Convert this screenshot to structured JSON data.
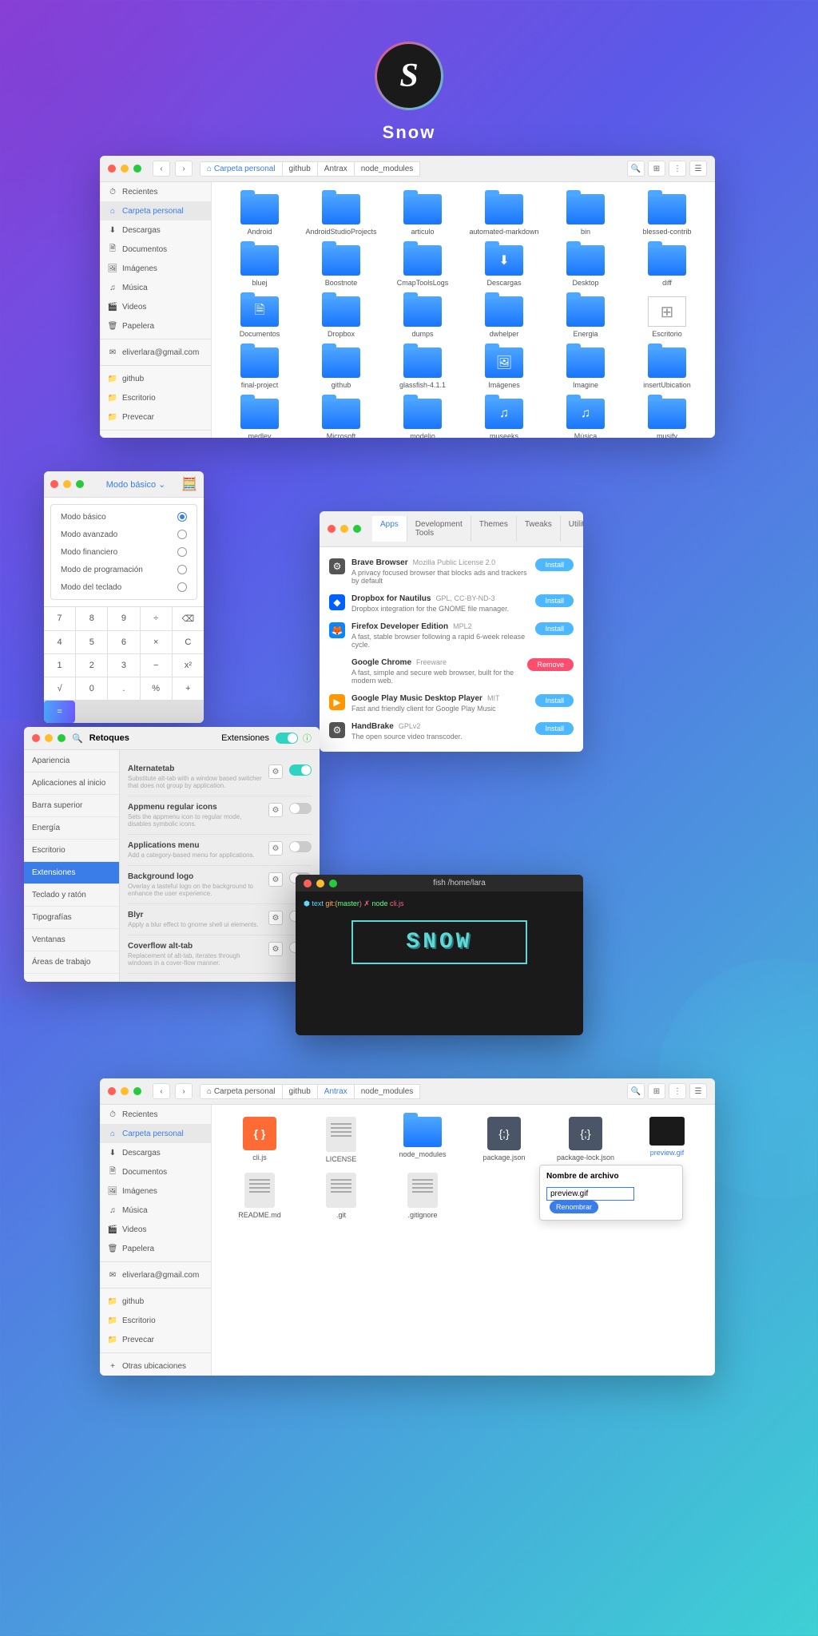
{
  "brand": {
    "letter": "S",
    "name": "Snow"
  },
  "fm": {
    "breadcrumbs": [
      "Carpeta personal",
      "github",
      "Antrax",
      "node_modules"
    ],
    "sidebar": [
      {
        "icon": "⏱",
        "label": "Recientes"
      },
      {
        "icon": "⌂",
        "label": "Carpeta personal",
        "active": true
      },
      {
        "icon": "⬇",
        "label": "Descargas"
      },
      {
        "icon": "🗎",
        "label": "Documentos"
      },
      {
        "icon": "🖼",
        "label": "Imágenes"
      },
      {
        "icon": "♫",
        "label": "Música"
      },
      {
        "icon": "🎬",
        "label": "Videos"
      },
      {
        "icon": "🗑",
        "label": "Papelera"
      },
      {
        "sep": true
      },
      {
        "icon": "✉",
        "label": "eliverlara@gmail.com"
      },
      {
        "sep": true
      },
      {
        "icon": "📁",
        "label": "github"
      },
      {
        "icon": "📁",
        "label": "Escritorio"
      },
      {
        "icon": "📁",
        "label": "Prevecar"
      },
      {
        "sep": true
      },
      {
        "icon": "+",
        "label": "Otras ubicaciones"
      }
    ],
    "folders": [
      "Android",
      "AndroidStudioProjects",
      "articulo",
      "automated-markdown",
      "bin",
      "blessed-contrib",
      "bluej",
      "Boostnote",
      "CmapToolsLogs",
      "Descargas",
      "Desktop",
      "diff",
      "Documentos",
      "Dropbox",
      "dumps",
      "dwhelper",
      "Energia",
      "Escritorio",
      "final-project",
      "github",
      "glassfish-4.1.1",
      "Imágenes",
      "Imagine",
      "insertUbication",
      "medley",
      "Microsoft",
      "modelio",
      "museeks",
      "Música",
      "musify"
    ]
  },
  "calc": {
    "title": "Modo básico",
    "options": [
      "Modo básico",
      "Modo avanzado",
      "Modo financiero",
      "Modo de programación",
      "Modo del teclado"
    ],
    "selected": 0,
    "keys": [
      "7",
      "8",
      "9",
      "÷",
      "⌫",
      "4",
      "5",
      "6",
      "×",
      "C",
      "1",
      "2",
      "3",
      "−",
      "x²",
      "√",
      "0",
      ".",
      "%",
      "+",
      "="
    ]
  },
  "sw": {
    "tabs": [
      "Apps",
      "Development Tools",
      "Themes",
      "Tweaks",
      "Utilities"
    ],
    "activeTab": 0,
    "items": [
      {
        "name": "Brave Browser",
        "lic": "Mozilla Public License 2.0",
        "desc": "A privacy focused browser that blocks ads and trackers by default",
        "btn": "Install",
        "icon": "⚙",
        "bg": "#555"
      },
      {
        "name": "Dropbox for Nautilus",
        "lic": "GPL, CC-BY-ND-3",
        "desc": "Dropbox integration for the GNOME file manager.",
        "btn": "Install",
        "icon": "◆",
        "bg": "#0061ff"
      },
      {
        "name": "Firefox Developer Edition",
        "lic": "MPL2",
        "desc": "A fast, stable browser following a rapid 6-week release cycle.",
        "btn": "Install",
        "icon": "🦊",
        "bg": "#0a84ff"
      },
      {
        "name": "Google Chrome",
        "lic": "Freeware",
        "desc": "A fast, simple and secure web browser, built for the modern web.",
        "btn": "Remove",
        "icon": "●",
        "bg": "#fff"
      },
      {
        "name": "Google Play Music Desktop Player",
        "lic": "MIT",
        "desc": "Fast and friendly client for Google Play Music",
        "btn": "Install",
        "icon": "▶",
        "bg": "#ff9800"
      },
      {
        "name": "HandBrake",
        "lic": "GPLv2",
        "desc": "The open source video transcoder.",
        "btn": "Install",
        "icon": "⚙",
        "bg": "#555"
      }
    ]
  },
  "tw": {
    "title1": "Retoques",
    "title2": "Extensiones",
    "sidebar": [
      "Apariencia",
      "Aplicaciones al inicio",
      "Barra superior",
      "Energía",
      "Escritorio",
      "Extensiones",
      "Teclado y ratón",
      "Tipografías",
      "Ventanas",
      "Áreas de trabajo"
    ],
    "activeSb": 5,
    "items": [
      {
        "name": "Alternatetab",
        "desc": "Substitute alt-tab with a window based switcher that does not group by application.",
        "on": true
      },
      {
        "name": "Appmenu regular icons",
        "desc": "Sets the appmenu icon to regular mode, disables symbolic icons.",
        "on": false
      },
      {
        "name": "Applications menu",
        "desc": "Add a category-based menu for applications.",
        "on": false
      },
      {
        "name": "Background logo",
        "desc": "Overlay a tasteful logo on the background to enhance the user experience.",
        "on": false
      },
      {
        "name": "Blyr",
        "desc": "Apply a blur effect to gnome shell ui elements.",
        "on": false
      },
      {
        "name": "Coverflow alt-tab",
        "desc": "Replacement of alt-tab, iterates through windows in a cover-flow manner.",
        "on": false
      }
    ]
  },
  "term": {
    "title": "fish /home/lara",
    "prompt": {
      "p1": "⬢ text",
      "p2": "git:(",
      "p3": "master",
      "p4": ") ✗",
      "cmd": "node",
      "arg": "cli.js"
    },
    "ascii": "SNOW"
  },
  "fm2": {
    "breadcrumbs": [
      "Carpeta personal",
      "github",
      "Antrax",
      "node_modules"
    ],
    "activeBc": 2,
    "files": [
      {
        "name": "cli.js",
        "type": "js"
      },
      {
        "name": "LICENSE",
        "type": "txt"
      },
      {
        "name": "node_modules",
        "type": "folder"
      },
      {
        "name": "package.json",
        "type": "json"
      },
      {
        "name": "package-lock.json",
        "type": "json"
      },
      {
        "name": "preview.gif",
        "type": "img",
        "selected": true
      },
      {
        "name": "README.md",
        "type": "txt"
      },
      {
        "name": ".git",
        "type": "txt"
      },
      {
        "name": ".gitignore",
        "type": "txt"
      }
    ],
    "rename": {
      "label": "Nombre de archivo",
      "value": "preview.gif",
      "btn": "Renombrar"
    }
  }
}
